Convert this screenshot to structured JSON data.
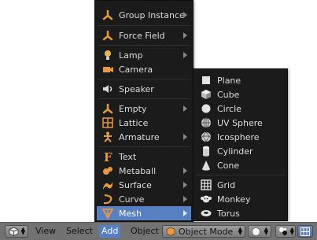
{
  "add_menu": {
    "items": [
      {
        "label": "Group Instance",
        "icon": "group-instance-icon",
        "submenu": true
      },
      {
        "label": "Force Field",
        "icon": "force-field-icon",
        "submenu": true
      },
      {
        "label": "Lamp",
        "icon": "lamp-icon",
        "submenu": true
      },
      {
        "label": "Camera",
        "icon": "camera-icon",
        "submenu": false
      },
      {
        "label": "Speaker",
        "icon": "speaker-icon",
        "submenu": false
      },
      {
        "label": "Empty",
        "icon": "empty-icon",
        "submenu": true
      },
      {
        "label": "Lattice",
        "icon": "lattice-icon",
        "submenu": false
      },
      {
        "label": "Armature",
        "icon": "armature-icon",
        "submenu": true
      },
      {
        "label": "Text",
        "icon": "text-icon",
        "submenu": false
      },
      {
        "label": "Metaball",
        "icon": "metaball-icon",
        "submenu": true
      },
      {
        "label": "Surface",
        "icon": "surface-icon",
        "submenu": true
      },
      {
        "label": "Curve",
        "icon": "curve-icon",
        "submenu": true
      },
      {
        "label": "Mesh",
        "icon": "mesh-icon",
        "submenu": true,
        "highlighted": true
      }
    ]
  },
  "mesh_menu": {
    "items": [
      {
        "label": "Plane",
        "icon": "plane-icon"
      },
      {
        "label": "Cube",
        "icon": "cube-icon"
      },
      {
        "label": "Circle",
        "icon": "circle-icon"
      },
      {
        "label": "UV Sphere",
        "icon": "uv-sphere-icon"
      },
      {
        "label": "Icosphere",
        "icon": "icosphere-icon"
      },
      {
        "label": "Cylinder",
        "icon": "cylinder-icon"
      },
      {
        "label": "Cone",
        "icon": "cone-icon"
      },
      {
        "label": "Grid",
        "icon": "grid-icon"
      },
      {
        "label": "Monkey",
        "icon": "monkey-icon"
      },
      {
        "label": "Torus",
        "icon": "torus-icon"
      }
    ]
  },
  "header": {
    "editor_type_icon": "3d-view-icon",
    "menus": {
      "view": "View",
      "select": "Select",
      "add": "Add",
      "object": "Object"
    },
    "mode_label": "Object Mode",
    "mode_icon": "object-mode-icon",
    "shading_icon": "solid-sphere-icon",
    "pivot_icon": "pivot-icon",
    "layers_icon": "layers-icon"
  },
  "colors": {
    "menu_bg": "#1b1b1b",
    "highlight": "#5680c2",
    "header_bg": "#727272",
    "icon_orange": "#e89a3c"
  }
}
